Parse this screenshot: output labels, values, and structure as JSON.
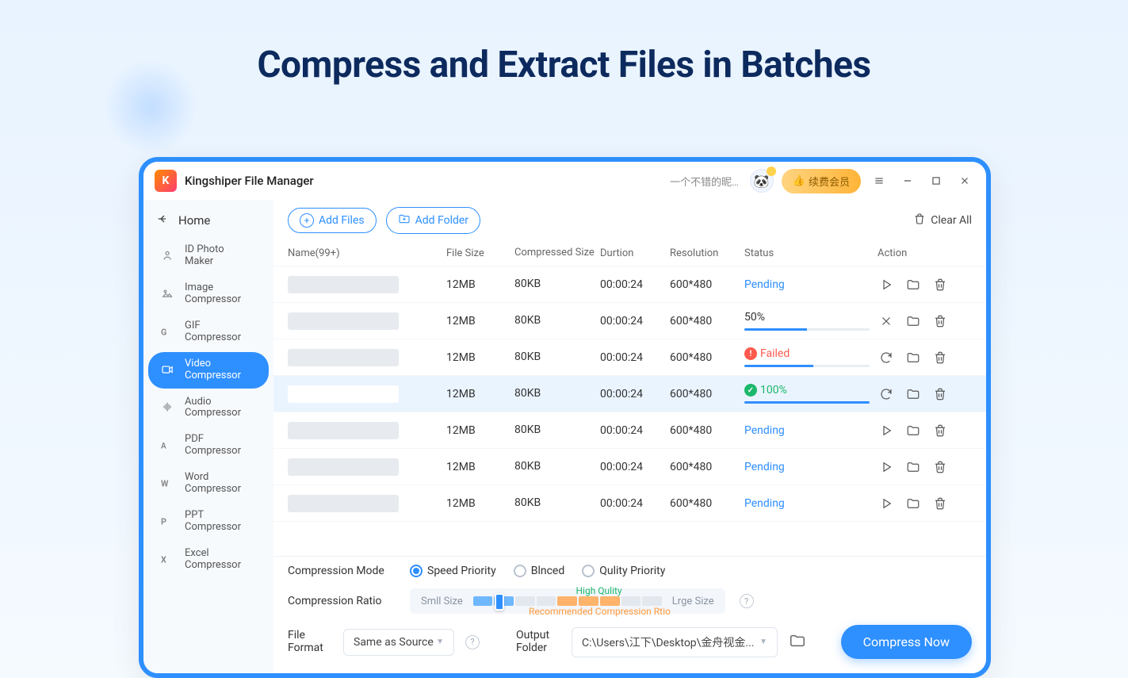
{
  "page_title": "Compress and Extract Files in Batches",
  "titlebar": {
    "logo_letter": "K",
    "app_name": "Kingshiper File Manager",
    "user_text": "一个不错的昵…",
    "renew_icon": "👍",
    "renew_label": "续费会员"
  },
  "sidebar": {
    "home_label": "Home",
    "items": [
      {
        "icon": "id",
        "line1": "ID Photo",
        "line2": "Maker"
      },
      {
        "icon": "img",
        "line1": "Image",
        "line2": "Compressor"
      },
      {
        "icon": "gif",
        "line1": "GIF",
        "line2": "Compressor"
      },
      {
        "icon": "vid",
        "line1": "Video",
        "line2": "Compressor",
        "active": true
      },
      {
        "icon": "aud",
        "line1": "Audio",
        "line2": "Compressor"
      },
      {
        "icon": "pdf",
        "line1": "PDF",
        "line2": "Compressor"
      },
      {
        "icon": "doc",
        "line1": "Word",
        "line2": "Compressor"
      },
      {
        "icon": "ppt",
        "line1": "PPT",
        "line2": "Compressor"
      },
      {
        "icon": "xls",
        "line1": "Excel",
        "line2": "Compressor"
      }
    ]
  },
  "toolbar": {
    "add_files": "Add Files",
    "add_folder": "Add Folder",
    "clear_all": "Clear All"
  },
  "table": {
    "headers": {
      "name": "Name(99+)",
      "size": "File Size",
      "compressed": "Compressed Size",
      "duration": "Durtion",
      "resolution": "Resolution",
      "status": "Status",
      "action": "Action"
    },
    "rows": [
      {
        "size": "12MB",
        "comp": "80KB",
        "dur": "00:00:24",
        "res": "600*480",
        "status_type": "pending",
        "status_text": "Pending",
        "actions": [
          "play",
          "folder",
          "trash"
        ]
      },
      {
        "size": "12MB",
        "comp": "80KB",
        "dur": "00:00:24",
        "res": "600*480",
        "status_type": "progress",
        "status_text": "50%",
        "progress": 50,
        "actions": [
          "cancel",
          "folder",
          "trash"
        ]
      },
      {
        "size": "12MB",
        "comp": "80KB",
        "dur": "00:00:24",
        "res": "600*480",
        "status_type": "failed",
        "status_text": "Failed",
        "progress": 55,
        "actions": [
          "retry",
          "folder",
          "trash"
        ]
      },
      {
        "size": "12MB",
        "comp": "80KB",
        "dur": "00:00:24",
        "res": "600*480",
        "status_type": "done",
        "status_text": "100%",
        "progress": 100,
        "highlight": true,
        "actions": [
          "retry",
          "folder",
          "trash"
        ]
      },
      {
        "size": "12MB",
        "comp": "80KB",
        "dur": "00:00:24",
        "res": "600*480",
        "status_type": "pending",
        "status_text": "Pending",
        "actions": [
          "play",
          "folder",
          "trash"
        ]
      },
      {
        "size": "12MB",
        "comp": "80KB",
        "dur": "00:00:24",
        "res": "600*480",
        "status_type": "pending",
        "status_text": "Pending",
        "actions": [
          "play",
          "folder",
          "trash"
        ]
      },
      {
        "size": "12MB",
        "comp": "80KB",
        "dur": "00:00:24",
        "res": "600*480",
        "status_type": "pending",
        "status_text": "Pending",
        "actions": [
          "play",
          "folder",
          "trash"
        ]
      }
    ]
  },
  "footer": {
    "mode_label": "Compression Mode",
    "mode_options": [
      "Speed Priority",
      "Blnced",
      "Qulity Priority"
    ],
    "mode_selected": 0,
    "ratio_label": "Compression Ratio",
    "small_label": "Smll Size",
    "large_label": "Lrge Size",
    "hq_label": "High Qulity",
    "rec_label": "Recommended Compression Rtio",
    "format_label1": "File",
    "format_label2": "Format",
    "format_value": "Same as Source",
    "output_label1": "Output",
    "output_label2": "Folder",
    "output_path": "C:\\Users\\江下\\Desktop\\金舟视金...",
    "compress_btn": "Compress Now"
  },
  "icons": {
    "help": "?"
  }
}
